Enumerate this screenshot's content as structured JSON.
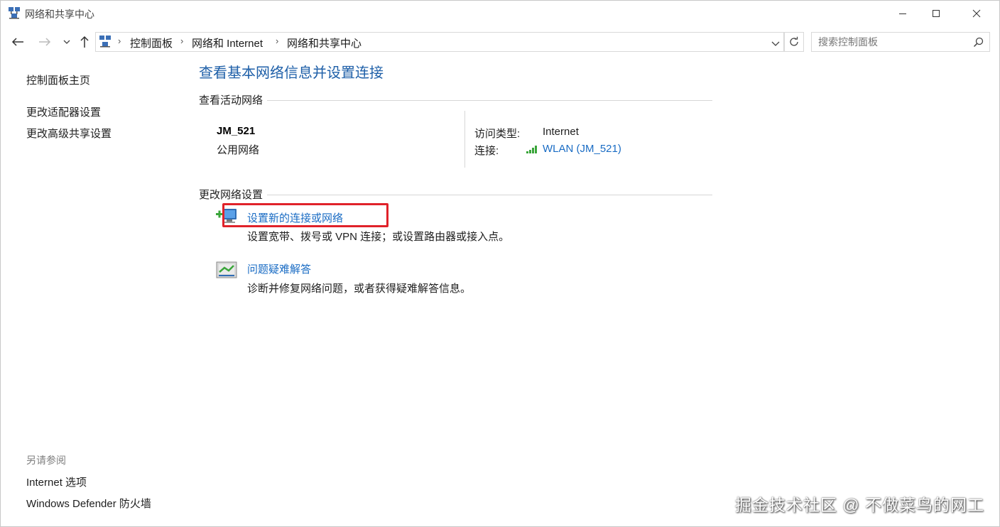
{
  "window": {
    "title": "网络和共享中心",
    "controls": [
      "minimize",
      "maximize",
      "close"
    ]
  },
  "addressbar": {
    "breadcrumb": [
      "控制面板",
      "网络和 Internet",
      "网络和共享中心"
    ],
    "search_placeholder": "搜索控制面板"
  },
  "sidebar": {
    "home_link": "控制面板主页",
    "links": [
      "更改适配器设置",
      "更改高级共享设置"
    ],
    "see_also_header": "另请参阅",
    "see_also": [
      "Internet 选项",
      "Windows Defender 防火墙"
    ]
  },
  "main": {
    "title": "查看基本网络信息并设置连接",
    "active_section_label": "查看活动网络",
    "network": {
      "name": "JM_521",
      "type": "公用网络",
      "access_type_label": "访问类型:",
      "access_type_value": "Internet",
      "connection_label": "连接:",
      "connection_value": "WLAN (JM_521)"
    },
    "change_section_label": "更改网络设置",
    "tasks": [
      {
        "title": "设置新的连接或网络",
        "description": "设置宽带、拨号或 VPN 连接；或设置路由器或接入点。",
        "icon": "new-connection-icon"
      },
      {
        "title": "问题疑难解答",
        "description": "诊断并修复网络问题，或者获得疑难解答信息。",
        "icon": "troubleshoot-icon"
      }
    ]
  },
  "annotation": {
    "highlight_color": "#e0222a"
  },
  "watermark": "掘金技术社区 @ 不做菜鸟的网工",
  "colors": {
    "link": "#1a6cc4",
    "title": "#1e5fa8",
    "signal": "#3aa53a"
  }
}
